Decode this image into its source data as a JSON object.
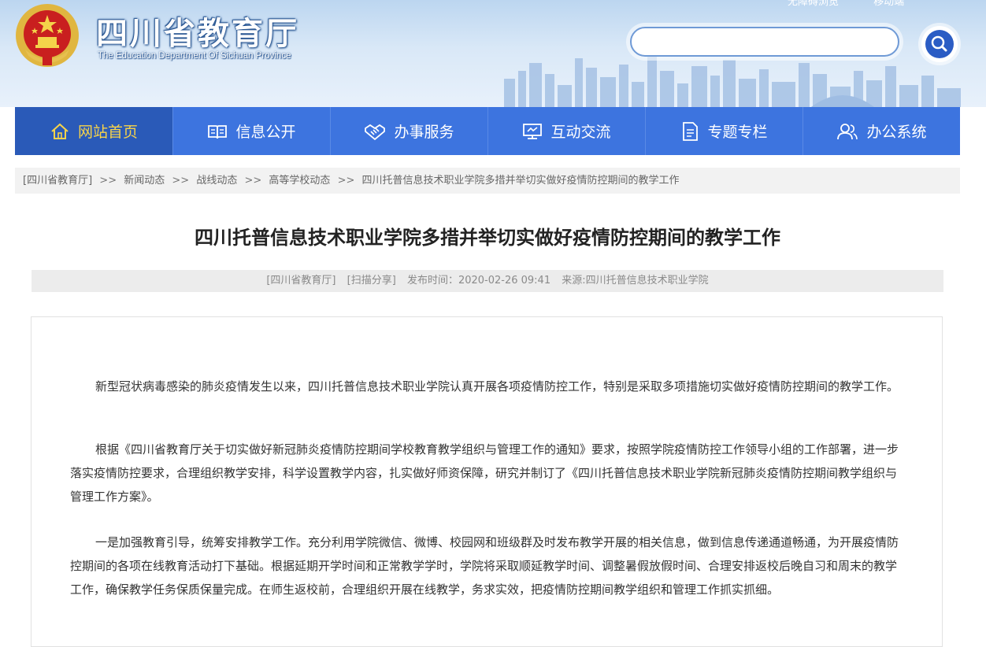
{
  "header": {
    "title": "四川省教育厅",
    "subtitle": "The Education Department Of Sichuan Province",
    "top_links": [
      "无障碍浏览",
      "移动端"
    ],
    "search_placeholder": "",
    "search_icon": "search-icon"
  },
  "nav": {
    "items": [
      {
        "label": "网站首页",
        "icon": "home-icon",
        "active": true
      },
      {
        "label": "信息公开",
        "icon": "book-icon",
        "active": false
      },
      {
        "label": "办事服务",
        "icon": "handshake-icon",
        "active": false
      },
      {
        "label": "互动交流",
        "icon": "monitor-icon",
        "active": false
      },
      {
        "label": "专题专栏",
        "icon": "document-icon",
        "active": false
      },
      {
        "label": "办公系统",
        "icon": "users-icon",
        "active": false
      }
    ],
    "active_color": "#f7d34a",
    "bar_color": "#3d74df"
  },
  "breadcrumb": {
    "items": [
      "[四川省教育厅]",
      "新闻动态",
      "战线动态",
      "高等学校动态",
      "四川托普信息技术职业学院多措并举切实做好疫情防控期间的教学工作"
    ],
    "separator": ">>"
  },
  "article": {
    "title": "四川托普信息技术职业学院多措并举切实做好疫情防控期间的教学工作",
    "meta": {
      "site": "[四川省教育厅]",
      "share": "[扫描分享]",
      "publish": "发布时间：2020-02-26 09:41",
      "source": "来源:四川托普信息技术职业学院"
    },
    "paragraphs": [
      "新型冠状病毒感染的肺炎疫情发生以来，四川托普信息技术职业学院认真开展各项疫情防控工作，特别是采取多项措施切实做好疫情防控期间的教学工作。",
      "根据《四川省教育厅关于切实做好新冠肺炎疫情防控期间学校教育教学组织与管理工作的通知》要求，按照学院疫情防控工作领导小组的工作部署，进一步落实疫情防控要求，合理组织教学安排，科学设置教学内容，扎实做好师资保障，研究并制订了《四川托普信息技术职业学院新冠肺炎疫情防控期间教学组织与管理工作方案》。",
      "一是加强教育引导，统筹安排教学工作。充分利用学院微信、微博、校园网和班级群及时发布教学开展的相关信息，做到信息传递通道畅通，为开展疫情防控期间的各项在线教育活动打下基础。根据延期开学时间和正常教学学时，学院将采取顺延教学时间、调整暑假放假时间、合理安排返校后晚自习和周末的教学工作，确保教学任务保质保量完成。在师生返校前，合理组织开展在线教学，务求实效，把疫情防控期间教学组织和管理工作抓实抓细。"
    ]
  }
}
